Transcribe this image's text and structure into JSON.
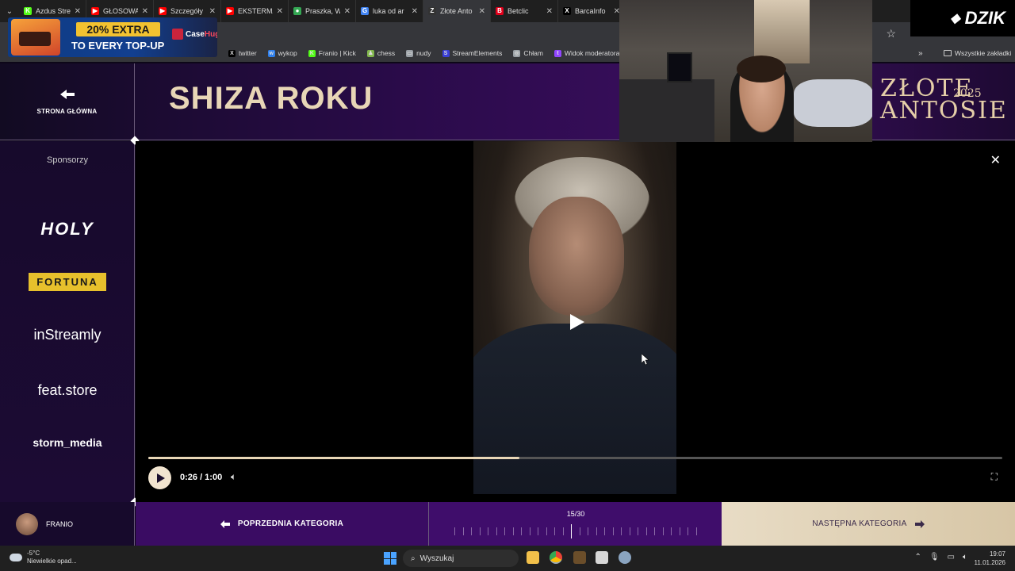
{
  "browser": {
    "tabs": [
      {
        "title": "Azdus Stre",
        "color": "#53fc18",
        "glyph": "K"
      },
      {
        "title": "GŁOSOWA",
        "color": "#ff0000",
        "glyph": "▶"
      },
      {
        "title": "Szczegóły",
        "color": "#ff0000",
        "glyph": "▶"
      },
      {
        "title": "EKSTERMA",
        "color": "#ff0000",
        "glyph": "▶"
      },
      {
        "title": "Praszka, W",
        "color": "#34a853",
        "glyph": "●"
      },
      {
        "title": "luka od ar",
        "color": "#4285f4",
        "glyph": "G"
      },
      {
        "title": "Złote Anto",
        "color": "#333333",
        "glyph": "Z"
      },
      {
        "title": "Betclic",
        "color": "#e3001b",
        "glyph": "B"
      },
      {
        "title": "BarcaInfo",
        "color": "#000000",
        "glyph": "X"
      }
    ],
    "bookmarks": [
      {
        "label": "twitter",
        "color": "#000000",
        "glyph": "X"
      },
      {
        "label": "wykop",
        "color": "#2f80ed",
        "glyph": "w"
      },
      {
        "label": "Franio | Kick",
        "color": "#53fc18",
        "glyph": "K"
      },
      {
        "label": "chess",
        "color": "#81b64c",
        "glyph": "♟"
      },
      {
        "label": "nudy",
        "color": "#9aa0a6",
        "glyph": "▭"
      },
      {
        "label": "StreamElements",
        "color": "#3a3fd8",
        "glyph": "S"
      },
      {
        "label": "Chłam",
        "color": "#9aa0a6",
        "glyph": "◎"
      },
      {
        "label": "Widok moderatora...",
        "color": "#9146ff",
        "glyph": "t"
      }
    ],
    "all_bookmarks": "Wszystkie zakładki"
  },
  "ad": {
    "line1": "20% EXTRA",
    "line2": "TO EVERY TOP-UP",
    "brand_a": "Case",
    "brand_b": "Hug"
  },
  "header": {
    "home_label": "STRONA GŁÓWNA",
    "title": "SHIZA ROKU",
    "logo_line1": "ZŁOTE",
    "logo_line2": "ANTOSIE",
    "logo_year": "2025"
  },
  "sidebar": {
    "title": "Sponsorzy",
    "sponsors": [
      "HOLY",
      "FORTUNA",
      "inStreamly",
      "feat.store",
      "storm_media"
    ]
  },
  "player": {
    "time": "0:26 / 1:00",
    "progress": 0.435
  },
  "overlay": {
    "brand": "DZIK"
  },
  "footer": {
    "username": "FRANIO",
    "prev_label": "POPRZEDNIA KATEGORIA",
    "counter": "15/30",
    "current_index": 15,
    "total": 30,
    "next_label": "NASTĘPNA KATEGORIA"
  },
  "taskbar": {
    "temp": "-5°C",
    "weather": "Niewielkie opad...",
    "search": "Wyszukaj",
    "time": "19:07",
    "date": "11.01.2026"
  }
}
